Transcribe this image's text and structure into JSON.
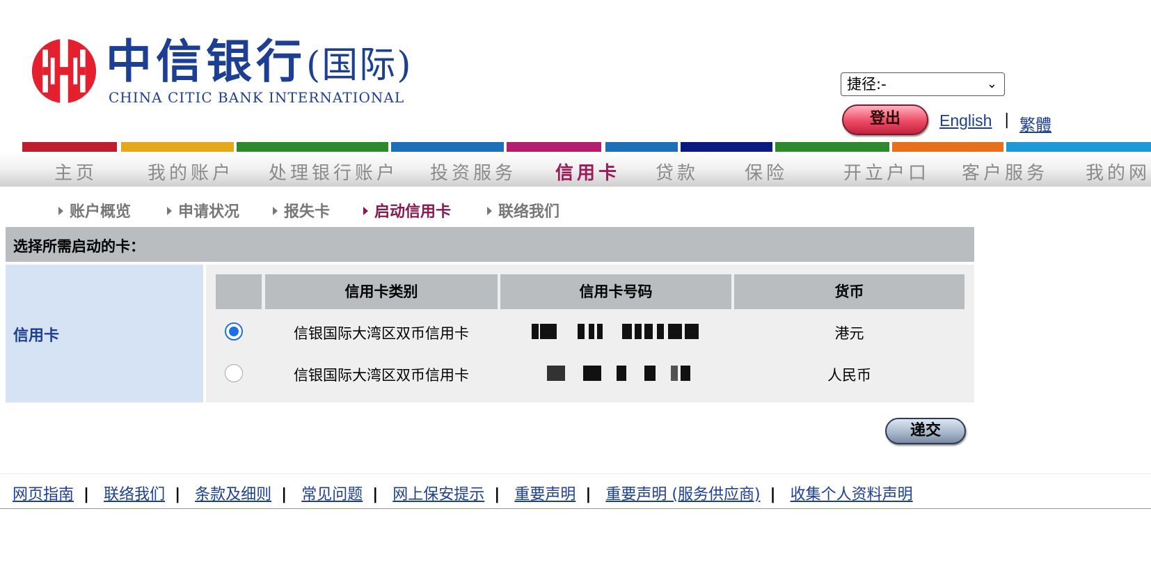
{
  "header": {
    "logo_cn": "中信银行",
    "logo_cn_paren": "(国际)",
    "logo_en": "CHINA CITIC BANK INTERNATIONAL",
    "shortcut_value": "捷径:-",
    "logout_label": "登出",
    "lang_english": "English",
    "lang_separator": "|",
    "lang_traditional": "繁體"
  },
  "nav": {
    "items": [
      "主页",
      "我的账户",
      "处理银行账户",
      "投资服务",
      "信用卡",
      "贷款",
      "保险",
      "开立户口",
      "客户服务",
      "我的网上"
    ],
    "active": "信用卡",
    "colors": [
      "#bf1e2e",
      "#e3a81c",
      "#2d8a2a",
      "#1d6fb8",
      "#b31e6f",
      "#1d6fb8",
      "#0a1a80",
      "#2d8a2a",
      "#e86f1c",
      "#1d9ad6"
    ]
  },
  "subnav": {
    "items": [
      "账户概览",
      "申请状况",
      "报失卡",
      "启动信用卡",
      "联络我们"
    ],
    "active": "启动信用卡"
  },
  "card_select": {
    "title": "选择所需启动的卡：",
    "row_label": "信用卡",
    "headers": [
      "",
      "信用卡类别",
      "信用卡号码",
      "货币"
    ],
    "rows": [
      {
        "selected": true,
        "type": "信银国际大湾区双币信用卡",
        "currency": "港元"
      },
      {
        "selected": false,
        "type": "信银国际大湾区双币信用卡",
        "currency": "人民币"
      }
    ],
    "submit_label": "递交"
  },
  "footer": {
    "links": [
      "网页指南",
      "联络我们",
      "条款及细则",
      "常见问题",
      "网上保安提示",
      "重要声明",
      "重要声明 (服务供应商)",
      "收集个人资料声明"
    ],
    "separator": "|"
  },
  "colors": {
    "brand_blue": "#1c3f94",
    "brand_red": "#e5202e",
    "active_magenta": "#8b1750",
    "panel_gray": "#babdc0",
    "label_blue_bg": "#d5e3f4"
  },
  "icons": {
    "logo_mark": "citic-logo-icon",
    "shortcut_dropdown": "chevron-down-icon",
    "subnav_bullet": "triangle-right-icon"
  }
}
